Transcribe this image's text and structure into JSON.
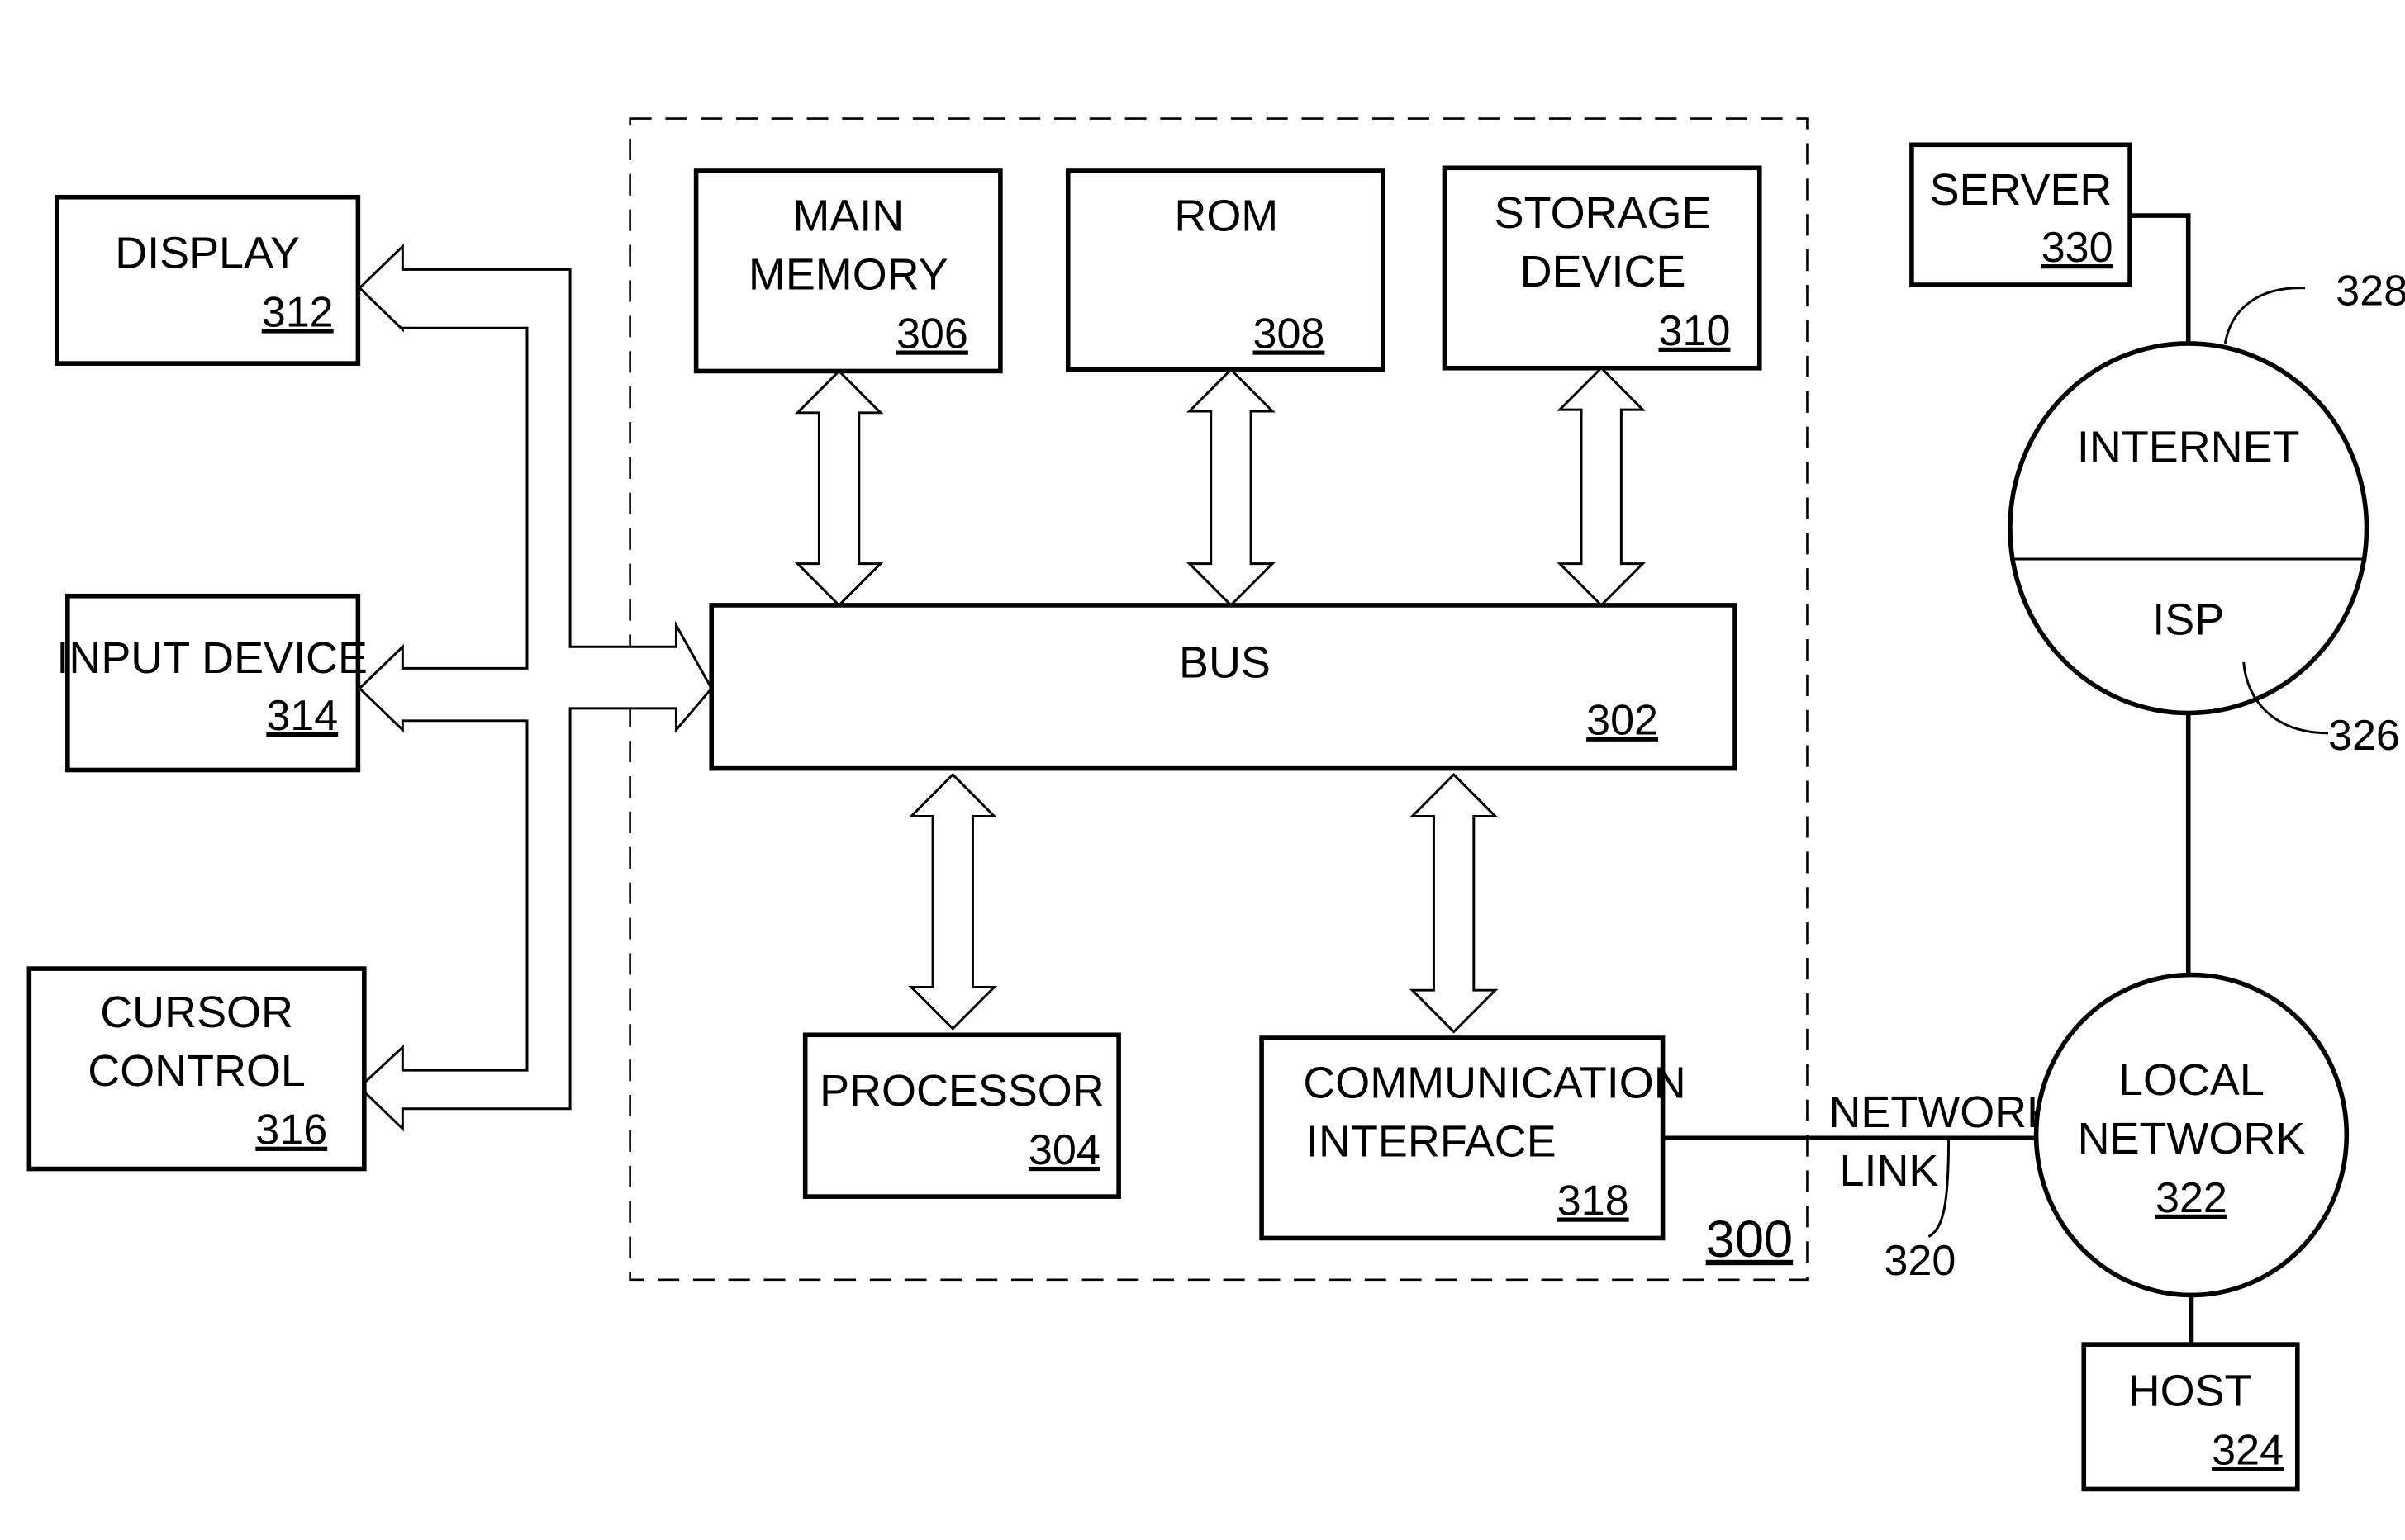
{
  "figure": {
    "system_ref": "300",
    "components": {
      "display": {
        "lines": [
          "DISPLAY"
        ],
        "ref": "312"
      },
      "input_device": {
        "lines": [
          "INPUT DEVICE"
        ],
        "ref": "314"
      },
      "cursor_control": {
        "lines": [
          "CURSOR",
          "CONTROL"
        ],
        "ref": "316"
      },
      "main_memory": {
        "lines": [
          "MAIN",
          "MEMORY"
        ],
        "ref": "306"
      },
      "rom": {
        "lines": [
          "ROM"
        ],
        "ref": "308"
      },
      "storage_device": {
        "lines": [
          "STORAGE",
          "DEVICE"
        ],
        "ref": "310"
      },
      "bus": {
        "lines": [
          "BUS"
        ],
        "ref": "302"
      },
      "processor": {
        "lines": [
          "PROCESSOR"
        ],
        "ref": "304"
      },
      "communication_interface": {
        "lines": [
          "COMMUNICATION",
          "INTERFACE"
        ],
        "ref": "318"
      },
      "server": {
        "lines": [
          "SERVER"
        ],
        "ref": "330"
      },
      "internet": {
        "lines": [
          "INTERNET"
        ],
        "ref": "328"
      },
      "isp": {
        "lines": [
          "ISP"
        ],
        "ref": "326"
      },
      "local_network": {
        "lines": [
          "LOCAL",
          "NETWORK"
        ],
        "ref": "322"
      },
      "host": {
        "lines": [
          "HOST"
        ],
        "ref": "324"
      }
    },
    "network_link": {
      "lines": [
        "NETWORK",
        "LINK"
      ],
      "ref": "320"
    }
  }
}
